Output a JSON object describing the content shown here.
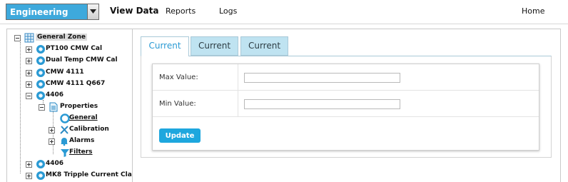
{
  "topbar": {
    "zone_select": {
      "value": "Engineering"
    },
    "nav": [
      {
        "label": "View Data",
        "active": true
      },
      {
        "label": "Reports",
        "active": false
      },
      {
        "label": "Logs",
        "active": false
      }
    ],
    "home_label": "Home"
  },
  "tree": {
    "root": {
      "label": "General Zone",
      "icon": "grid-icon"
    },
    "nodes": [
      {
        "label": "PT100 CMW Cal",
        "icon": "sensor-icon"
      },
      {
        "label": "Dual Temp CMW Cal",
        "icon": "sensor-icon"
      },
      {
        "label": "CMW 4111",
        "icon": "sensor-icon"
      },
      {
        "label": "CMW 4111 Q667",
        "icon": "sensor-icon"
      },
      {
        "label": "4406",
        "icon": "sensor-icon"
      },
      {
        "label": "Properties",
        "icon": "document-icon"
      },
      {
        "label": "General",
        "icon": "circle-icon"
      },
      {
        "label": "Calibration",
        "icon": "tools-icon"
      },
      {
        "label": "Alarms",
        "icon": "bell-icon"
      },
      {
        "label": "Filters",
        "icon": "funnel-icon"
      },
      {
        "label": "4406",
        "icon": "sensor-icon"
      },
      {
        "label": "MK8 Tripple Current Cla",
        "icon": "sensor-icon"
      }
    ]
  },
  "tabs": [
    {
      "label": "Current",
      "active": true
    },
    {
      "label": "Current",
      "active": false
    },
    {
      "label": "Current",
      "active": false
    }
  ],
  "form": {
    "max_value": {
      "label": "Max Value:",
      "value": ""
    },
    "min_value": {
      "label": "Min Value:",
      "value": ""
    },
    "update_label": "Update"
  },
  "colors": {
    "accent": "#3ea9dc",
    "tab_inactive": "#bfe3f1",
    "button": "#1ea7de"
  }
}
